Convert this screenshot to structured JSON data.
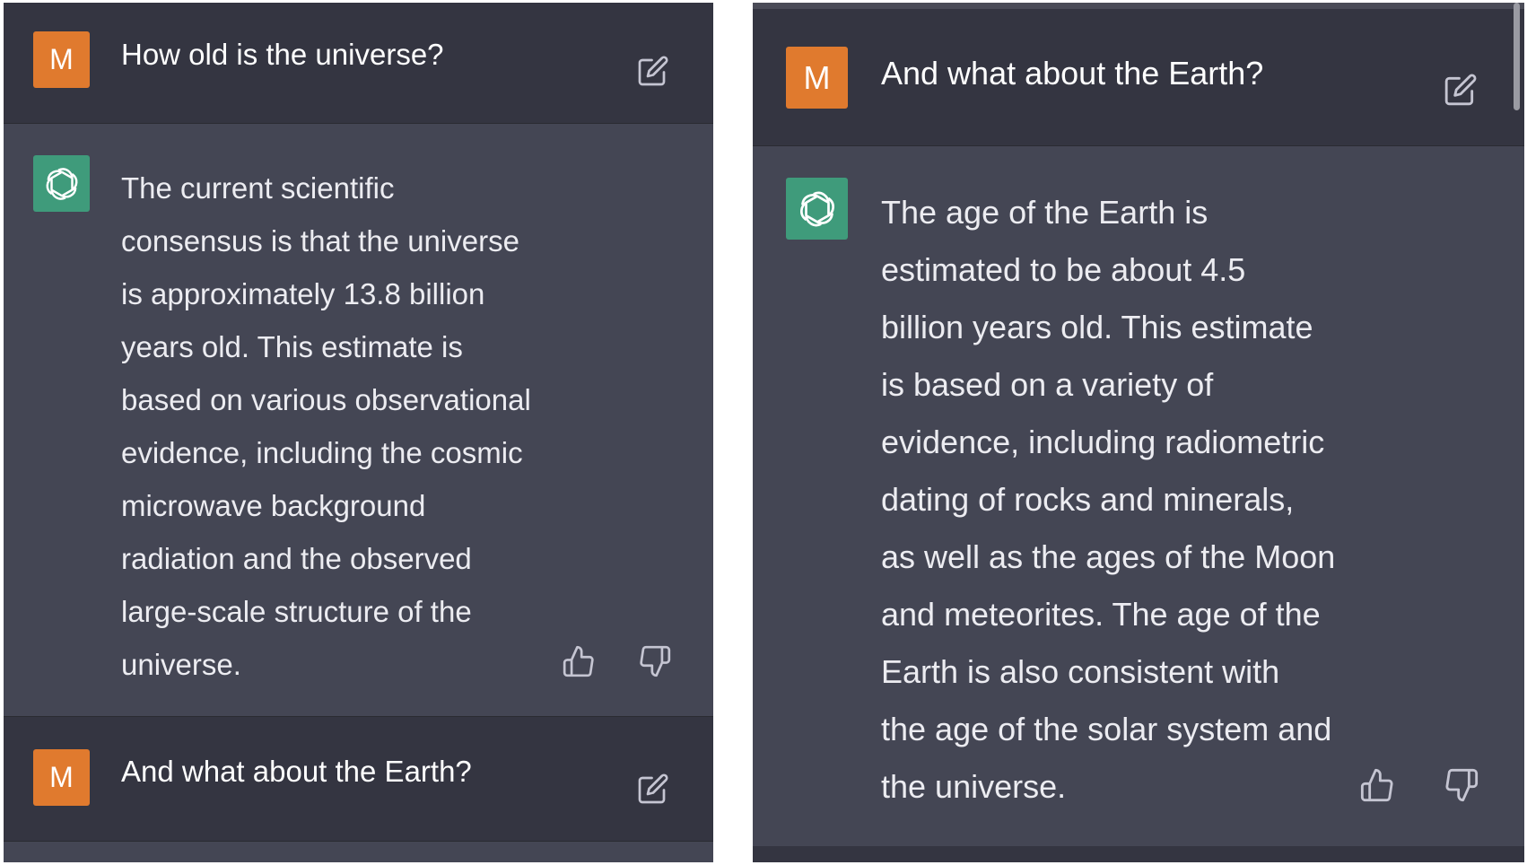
{
  "left_panel": {
    "user_message_1": {
      "avatar_letter": "M",
      "text": "How old is the universe?"
    },
    "assistant_message_1": {
      "text": "The current scientific\nconsensus is that the universe\nis approximately 13.8 billion\nyears old. This estimate is\nbased on various observational\nevidence, including the cosmic\nmicrowave background\nradiation and the observed\nlarge-scale structure of the\nuniverse."
    },
    "user_message_2": {
      "avatar_letter": "M",
      "text": "And what about the Earth?"
    }
  },
  "right_panel": {
    "user_message_1": {
      "avatar_letter": "M",
      "text": "And what about the Earth?"
    },
    "assistant_message_1": {
      "text": "The age of the Earth is\nestimated to be about 4.5\nbillion years old. This estimate\nis based on a variety of\nevidence, including radiometric\ndating of rocks and minerals,\nas well as the ages of the Moon\nand meteorites. The age of the\nEarth is also consistent with\nthe age of the solar system and\nthe universe."
    }
  },
  "icons": {
    "edit": "edit-icon",
    "thumbs_up": "thumbs-up-icon",
    "thumbs_down": "thumbs-down-icon",
    "assistant_logo": "openai-logo-icon"
  },
  "colors": {
    "user_bg": "#343541",
    "assistant_bg": "#444654",
    "user_avatar": "#e07a2e",
    "assistant_avatar": "#3f9b7b",
    "text": "#ececf1"
  }
}
